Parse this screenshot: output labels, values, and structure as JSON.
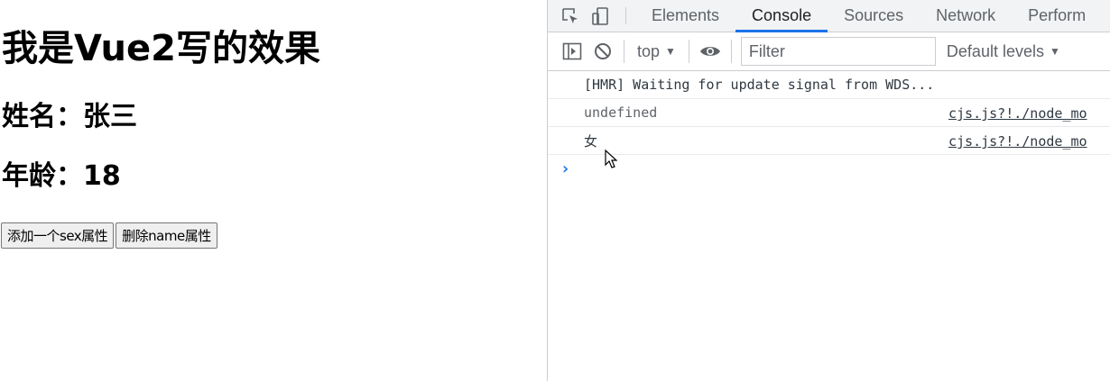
{
  "app": {
    "title": "我是Vue2写的效果",
    "name_line": "姓名：张三",
    "age_line": "年龄：18",
    "buttons": {
      "add_sex": "添加一个sex属性",
      "delete_name": "删除name属性"
    }
  },
  "devtools": {
    "icons": {
      "inspect": "inspect-element-icon",
      "device": "device-toolbar-icon",
      "sidebar": "console-sidebar-icon",
      "clear": "clear-console-icon",
      "eye": "live-expression-eye-icon"
    },
    "tabs": [
      {
        "label": "Elements",
        "active": false
      },
      {
        "label": "Console",
        "active": true
      },
      {
        "label": "Sources",
        "active": false
      },
      {
        "label": "Network",
        "active": false
      },
      {
        "label": "Perform",
        "active": false
      }
    ],
    "toolbar": {
      "context": "top",
      "filter_placeholder": "Filter",
      "levels": "Default levels"
    },
    "messages": [
      {
        "text": "[HMR] Waiting for update signal from WDS...",
        "source": ""
      },
      {
        "text": "undefined",
        "source": "cjs.js?!./node_mo"
      },
      {
        "text": "女",
        "source": "cjs.js?!./node_mo"
      }
    ],
    "prompt": "›",
    "colors": {
      "accent": "#1a73e8",
      "tabbar_bg": "#f1f3f4",
      "border": "#cbcdd1"
    }
  }
}
